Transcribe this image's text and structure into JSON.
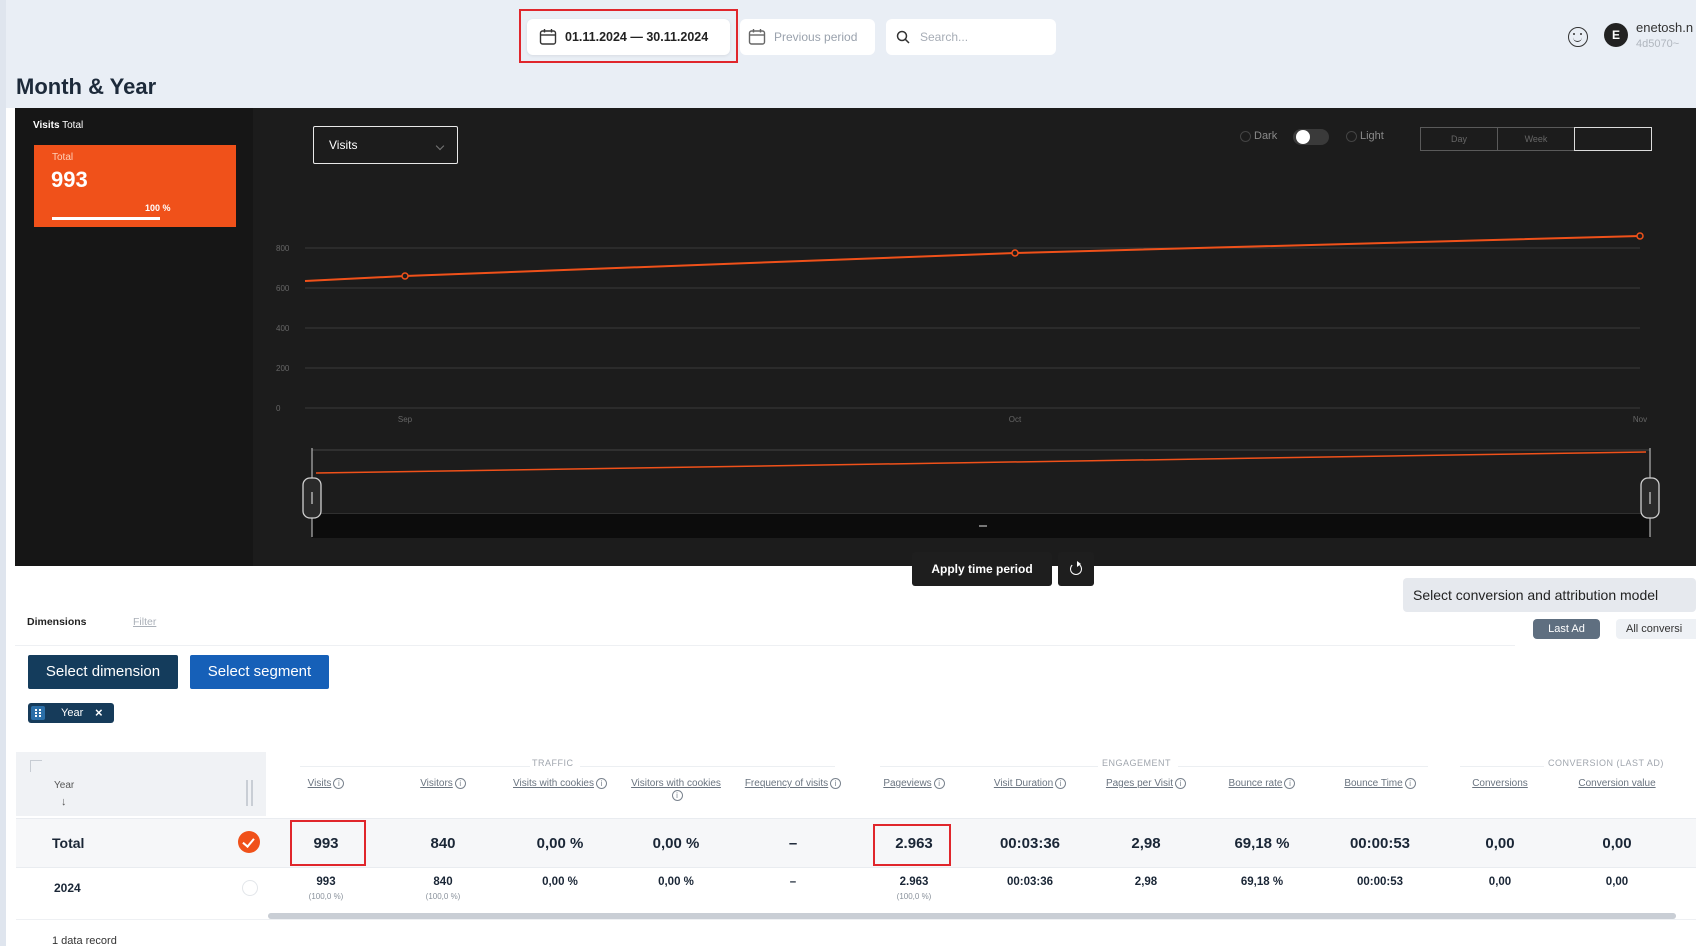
{
  "header": {
    "date_range": "01.11.2024 — 30.11.2024",
    "previous_period": "Previous period",
    "search_placeholder": "Search...",
    "user_initial": "E",
    "user_name": "enetosh.n",
    "user_sub": "4d5070~"
  },
  "page": {
    "title": "Month & Year"
  },
  "sidebar": {
    "visits_label": "Visits",
    "total_suffix": "Total",
    "card_label": "Total",
    "card_value": "993",
    "card_percent": "100 %",
    "card_fill": 1.0
  },
  "chart_controls": {
    "metric": "Visits",
    "dark_label": "Dark",
    "light_label": "Light",
    "granularity": [
      "Day",
      "Week",
      ""
    ],
    "apply_label": "Apply time period"
  },
  "chart_data": {
    "type": "line",
    "x": [
      "Sep",
      "Oct",
      "Nov"
    ],
    "series": [
      {
        "values": [
          660,
          775,
          860
        ],
        "color": "#f0511a"
      }
    ],
    "yticks": [
      "0",
      "200",
      "400",
      "600",
      "800"
    ],
    "ylim": [
      0,
      1000
    ],
    "grid": true
  },
  "attribution": {
    "title": "Select conversion and attribution model",
    "last_ad": "Last Ad",
    "all_conversions": "All conversi"
  },
  "dimensions": {
    "tab_dimensions": "Dimensions",
    "tab_filter": "Filter",
    "select_dimension": "Select dimension",
    "select_segment": "Select segment",
    "chip_label": "Year"
  },
  "table": {
    "dim_header": "Year",
    "sort_arrow": "↓",
    "groups": {
      "traffic": "TRAFFIC",
      "engagement": "ENGAGEMENT",
      "conversion": "CONVERSION (LAST AD)"
    },
    "columns": [
      {
        "label": "Visits",
        "info": true
      },
      {
        "label": "Visitors",
        "info": true
      },
      {
        "label": "Visits with cookies",
        "info": true
      },
      {
        "label": "Visitors with cookies",
        "info": true
      },
      {
        "label": "Frequency of visits",
        "info": true
      },
      {
        "label": "Pageviews",
        "info": true
      },
      {
        "label": "Visit Duration",
        "info": true
      },
      {
        "label": "Pages per Visit",
        "info": true
      },
      {
        "label": "Bounce rate",
        "info": true
      },
      {
        "label": "Bounce Time",
        "info": true
      },
      {
        "label": "Conversions",
        "info": false
      },
      {
        "label": "Conversion value",
        "info": false
      }
    ],
    "total_row": {
      "label": "Total",
      "values": [
        "993",
        "840",
        "0,00 %",
        "0,00 %",
        "–",
        "2.963",
        "00:03:36",
        "2,98",
        "69,18 %",
        "00:00:53",
        "0,00",
        "0,00"
      ]
    },
    "rows": [
      {
        "label": "2024",
        "values": [
          "993",
          "840",
          "0,00 %",
          "0,00 %",
          "–",
          "2.963",
          "00:03:36",
          "2,98",
          "69,18 %",
          "00:00:53",
          "0,00",
          "0,00"
        ],
        "subs": [
          "(100,0 %)",
          "(100,0 %)",
          "",
          "",
          "",
          "(100,0 %)",
          "",
          "",
          "",
          "",
          "",
          ""
        ]
      }
    ],
    "record_count": "1 data record"
  }
}
